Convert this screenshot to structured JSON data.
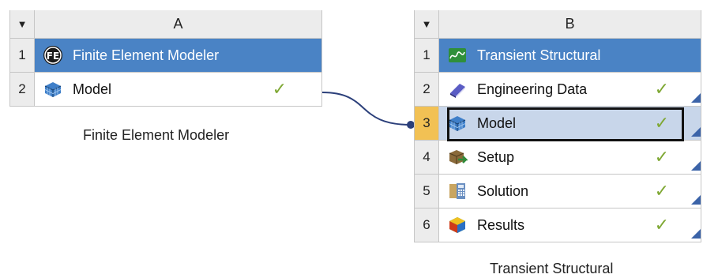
{
  "systemA": {
    "column_letter": "A",
    "rows": [
      {
        "num": "1",
        "label": "Finite Element Modeler",
        "icon": "fe-icon"
      },
      {
        "num": "2",
        "label": "Model",
        "icon": "model-icon",
        "status": "✓"
      }
    ],
    "caption": "Finite Element Modeler"
  },
  "systemB": {
    "column_letter": "B",
    "rows": [
      {
        "num": "1",
        "label": "Transient Structural",
        "icon": "transient-structural-icon"
      },
      {
        "num": "2",
        "label": "Engineering Data",
        "icon": "engineering-data-icon",
        "status": "✓"
      },
      {
        "num": "3",
        "label": "Model",
        "icon": "model-icon",
        "status": "✓"
      },
      {
        "num": "4",
        "label": "Setup",
        "icon": "setup-icon",
        "status": "✓"
      },
      {
        "num": "5",
        "label": "Solution",
        "icon": "solution-icon",
        "status": "✓"
      },
      {
        "num": "6",
        "label": "Results",
        "icon": "results-icon",
        "status": "✓"
      }
    ],
    "caption": "Transient Structural"
  },
  "colors": {
    "title_row": "#4a83c5",
    "selected_row": "#c8d6ea",
    "selected_number": "#f2c154",
    "check": "#7fa834",
    "link_line": "#2b3f7a"
  }
}
